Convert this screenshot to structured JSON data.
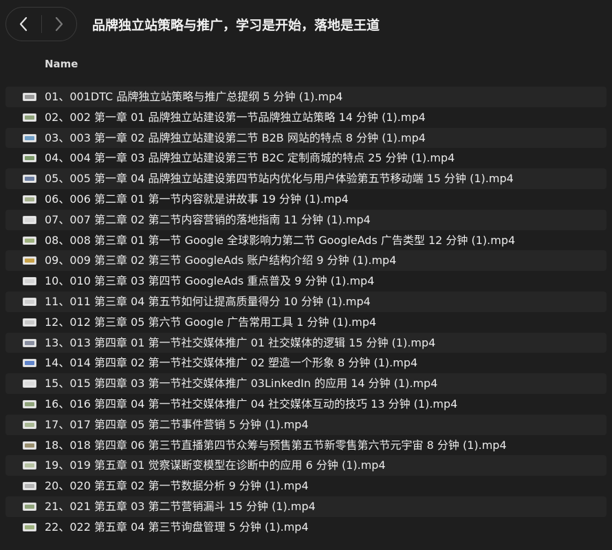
{
  "window": {
    "title": "品牌独立站策略与推广，学习是开始，落地是王道"
  },
  "navigation": {
    "back_icon": "chevron-left-icon",
    "forward_icon": "chevron-right-icon"
  },
  "table": {
    "column_name": "Name",
    "files": [
      {
        "name": "01、001DTC 品牌独立站策略与推广总提纲 5 分钟 (1).mp4",
        "thumb": "#9a9a9a"
      },
      {
        "name": "02、002 第一章 01 品牌独立站建设第一节品牌独立站策略 14 分钟 (1).mp4",
        "thumb": "#8fa37a"
      },
      {
        "name": "03、003 第一章 02 品牌独立站建设第二节 B2B 网站的特点 8 分钟 (1).mp4",
        "thumb": "#6f9ec7"
      },
      {
        "name": "04、004 第一章 03 品牌独立站建设第三节 B2C 定制商城的特点 25 分钟 (1).mp4",
        "thumb": "#7d9a6a"
      },
      {
        "name": "05、005 第一章 04 品牌独立站建设第四节站内优化与用户体验第五节移动端 15 分钟 (1).mp4",
        "thumb": "#6d7fa3"
      },
      {
        "name": "06、006 第二章 01 第一节内容就是讲故事 19 分钟 (1).mp4",
        "thumb": "#a4b08c"
      },
      {
        "name": "07、007 第二章 02 第二节内容营销的落地指南 11 分钟 (1).mp4",
        "thumb": "#d9d9d9"
      },
      {
        "name": "08、008 第三章 01 第一节 Google 全球影响力第二节 GoogleAds 广告类型 12 分钟 (1).mp4",
        "thumb": "#9db07e"
      },
      {
        "name": "09、009 第三章 02 第三节 GoogleAds 账户结构介绍 9 分钟 (1).mp4",
        "thumb": "#c7a24a"
      },
      {
        "name": "10、010 第三章 03 第四节 GoogleAds 重点普及 9 分钟 (1).mp4",
        "thumb": "#d4d4d4"
      },
      {
        "name": "11、011 第三章 04 第五节如何让提高质量得分 10 分钟 (1).mp4",
        "thumb": "#cfcfcf"
      },
      {
        "name": "12、012 第三章 05 第六节 Google 广告常用工具 1 分钟 (1).mp4",
        "thumb": "#c9c9c9"
      },
      {
        "name": "13、013 第四章 01 第一节社交媒体推广 01 社交媒体的逻辑 15 分钟 (1).mp4",
        "thumb": "#8a8fa0"
      },
      {
        "name": "14、014 第四章 02 第一节社交媒体推广 02 塑造一个形象 8 分钟 (1).mp4",
        "thumb": "#5f83c9"
      },
      {
        "name": "15、015 第四章 03 第一节社交媒体推广 03LinkedIn 的应用 14 分钟 (1).mp4",
        "thumb": "#dcdcdc"
      },
      {
        "name": "16、016 第四章 04 第一节社交媒体推广 04 社交媒体互动的技巧 13 分钟 (1).mp4",
        "thumb": "#8fa37a"
      },
      {
        "name": "17、017 第四章 05 第二节事件营销 5 分钟 (1).mp4",
        "thumb": "#a9b893"
      },
      {
        "name": "18、018 第四章 06 第三节直播第四节众筹与预售第五节新零售第六节元宇宙 8 分钟 (1).mp4",
        "thumb": "#9a8f6e"
      },
      {
        "name": "19、019 第五章 01 觉察谋断变模型在诊断中的应用 6 分钟 (1).mp4",
        "thumb": "#b7c3a2"
      },
      {
        "name": "20、020 第五章 02 第一节数据分析 9 分钟 (1).mp4",
        "thumb": "#b5b5b5"
      },
      {
        "name": "21、021 第五章 03 第二节营销漏斗 15 分钟 (1).mp4",
        "thumb": "#8fa37a"
      },
      {
        "name": "22、022 第五章 04 第三节询盘管理 5 分钟 (1).mp4",
        "thumb": "#9db07e"
      }
    ]
  },
  "colors": {
    "background": "#1e1e1e",
    "row_alt": "#262626",
    "text": "#ececec"
  }
}
